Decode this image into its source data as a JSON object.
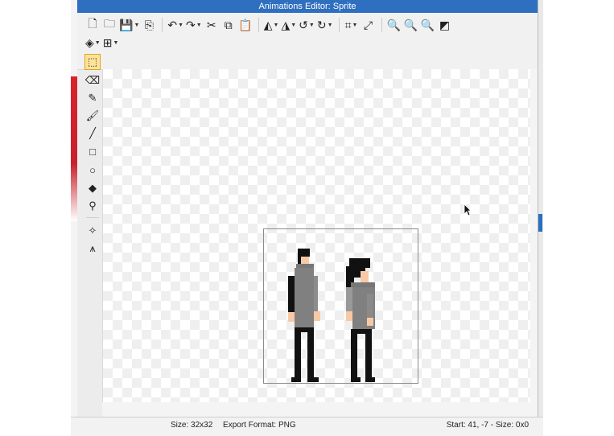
{
  "window": {
    "title": "Animations Editor: Sprite"
  },
  "toolbar": {
    "row1": [
      {
        "name": "new-file-icon",
        "glyph": "🗋"
      },
      {
        "name": "open-folder-icon",
        "glyph": "🗀"
      },
      {
        "name": "save-icon",
        "glyph": "💾",
        "caret": true
      },
      {
        "name": "export-icon",
        "glyph": "⎘"
      },
      {
        "name": "undo-icon",
        "glyph": "↶",
        "caret": true
      },
      {
        "name": "redo-icon",
        "glyph": "↷",
        "caret": true
      },
      {
        "name": "cut-icon",
        "glyph": "✂"
      },
      {
        "name": "copy-icon",
        "glyph": "⧉"
      },
      {
        "name": "paste-icon",
        "glyph": "📋"
      },
      {
        "name": "flip-horizontal-icon",
        "glyph": "◭",
        "caret": true
      },
      {
        "name": "flip-vertical-icon",
        "glyph": "◮",
        "caret": true
      },
      {
        "name": "rotate-left-icon",
        "glyph": "↺",
        "caret": true
      },
      {
        "name": "rotate-right-icon",
        "glyph": "↻",
        "caret": true
      },
      {
        "name": "crop-icon",
        "glyph": "⌗",
        "caret": true
      },
      {
        "name": "resize-icon",
        "glyph": "⤢"
      },
      {
        "name": "zoom-in-icon",
        "glyph": "🔍"
      },
      {
        "name": "zoom-out-icon",
        "glyph": "🔍"
      },
      {
        "name": "zoom-fit-icon",
        "glyph": "🔍"
      },
      {
        "name": "color-toggle-icon",
        "glyph": "◩"
      }
    ],
    "row2": [
      {
        "name": "layers-icon",
        "glyph": "◈",
        "caret": true
      },
      {
        "name": "grid-icon",
        "glyph": "⊞",
        "caret": true
      }
    ]
  },
  "tools": [
    {
      "name": "select-rectangle-icon",
      "glyph": "⬚",
      "active": true
    },
    {
      "name": "eraser-icon",
      "glyph": "⌫"
    },
    {
      "name": "pencil-icon",
      "glyph": "✎"
    },
    {
      "name": "brush-icon",
      "glyph": "🖌"
    },
    {
      "name": "line-icon",
      "glyph": "╱"
    },
    {
      "name": "rectangle-icon",
      "glyph": "□"
    },
    {
      "name": "ellipse-icon",
      "glyph": "○"
    },
    {
      "name": "fill-bucket-icon",
      "glyph": "◆"
    },
    {
      "name": "eyedropper-icon",
      "glyph": "⚲"
    },
    {
      "name": "point-icon",
      "glyph": "✧"
    },
    {
      "name": "vertex-icon",
      "glyph": "⩚"
    }
  ],
  "status": {
    "size": "Size: 32x32",
    "export_format": "Export Format: PNG",
    "cursor_info": "Start: 41, -7 - Size: 0x0"
  },
  "colors": {
    "titlebar": "#2f6fbf",
    "accent_active_tool": "#fde39a",
    "sprite_gray": "#808080",
    "sprite_skin": "#f7c9a7",
    "sprite_black": "#111111"
  }
}
